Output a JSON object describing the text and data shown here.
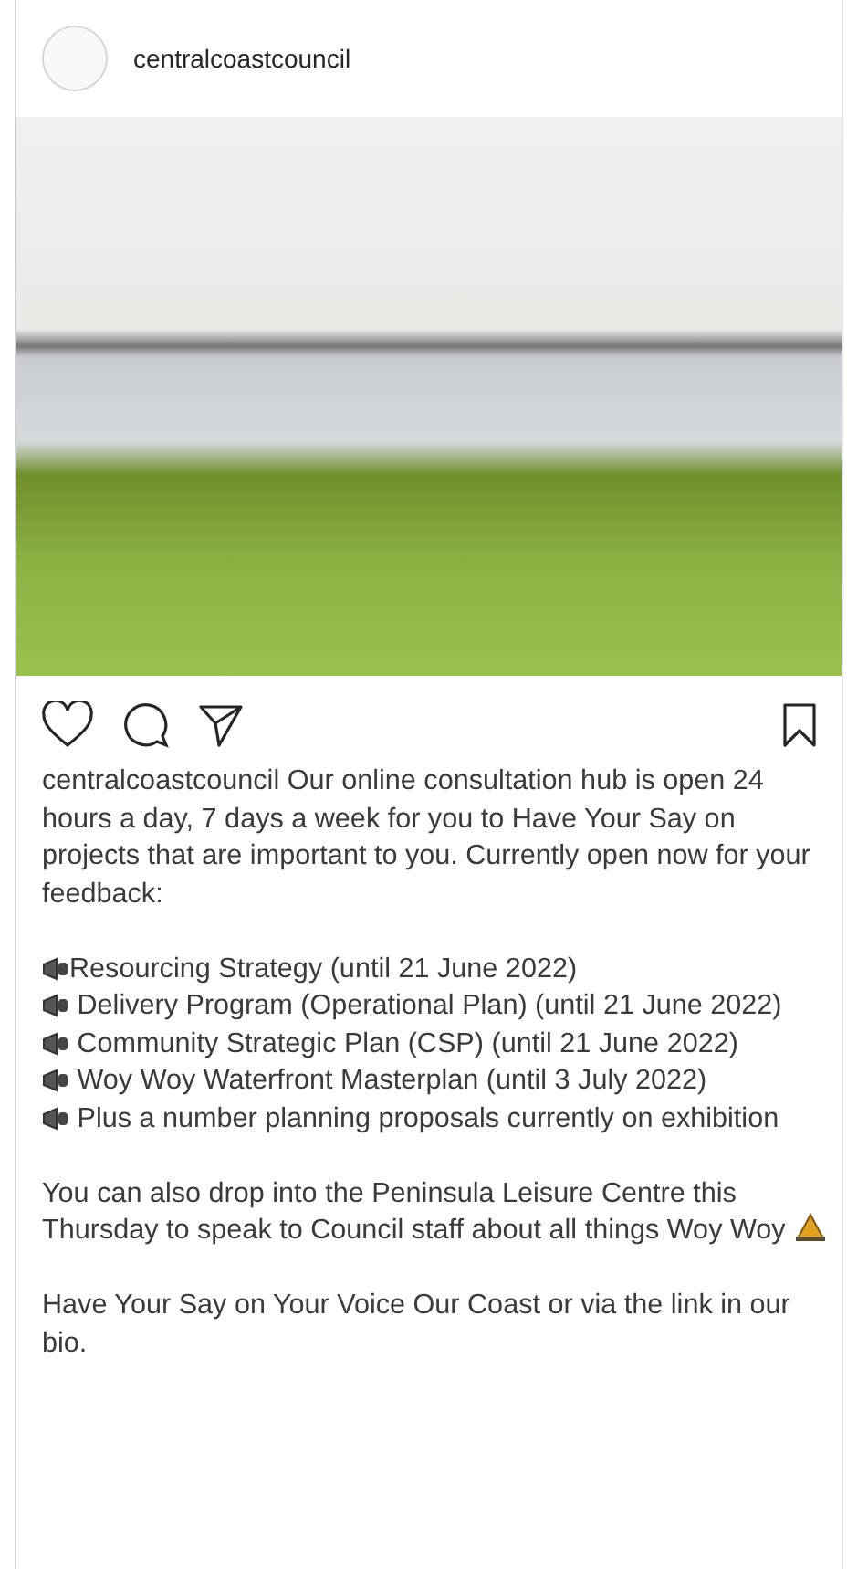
{
  "header": {
    "username": "centralcoastcouncil"
  },
  "caption": {
    "username": "centralcoastcouncil",
    "intro": "Our online consultation hub is open 24 hours a day, 7 days a week for you to Have Your Say on projects that are important to you. Currently open now for your feedback:",
    "items": [
      "Resourcing Strategy (until 21 June 2022)",
      "Delivery Program (Operational Plan) (until 21 June 2022)",
      "Community Strategic Plan (CSP) (until 21 June 2022)",
      "Woy Woy Waterfront Masterplan (until 3 July 2022)",
      "Plus a number planning proposals currently on exhibition"
    ],
    "paragraphs": [
      "You can also drop into the Peninsula Leisure Centre this Thursday to speak to Council staff about all things Woy Woy",
      "Have Your Say on Your Voice Our Coast or via the link in our bio."
    ]
  }
}
